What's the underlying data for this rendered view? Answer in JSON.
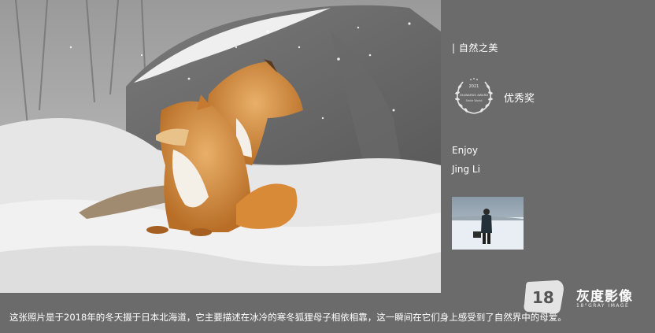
{
  "category": "| 自然之美",
  "award": {
    "year": "2021",
    "name": "35AWARDS AWARD",
    "subtitle": "Smile World",
    "label": "优秀奖"
  },
  "photo": {
    "title": "Enjoy",
    "photographer": "Jing Li"
  },
  "caption": "这张照片是于2018年的冬天摄于日本北海道，它主要描述在冰冷的寒冬狐狸母子相依相靠，这一瞬间在它们身上感受到了自然界中的母爱。",
  "watermark": {
    "logo_text": "18",
    "brand": "灰度影像",
    "subtitle": "18°GRAY IMAGE"
  },
  "colors": {
    "background": "#6b6b6b",
    "fox_orange": "#d08a3a",
    "snow": "#e8e8e8"
  }
}
